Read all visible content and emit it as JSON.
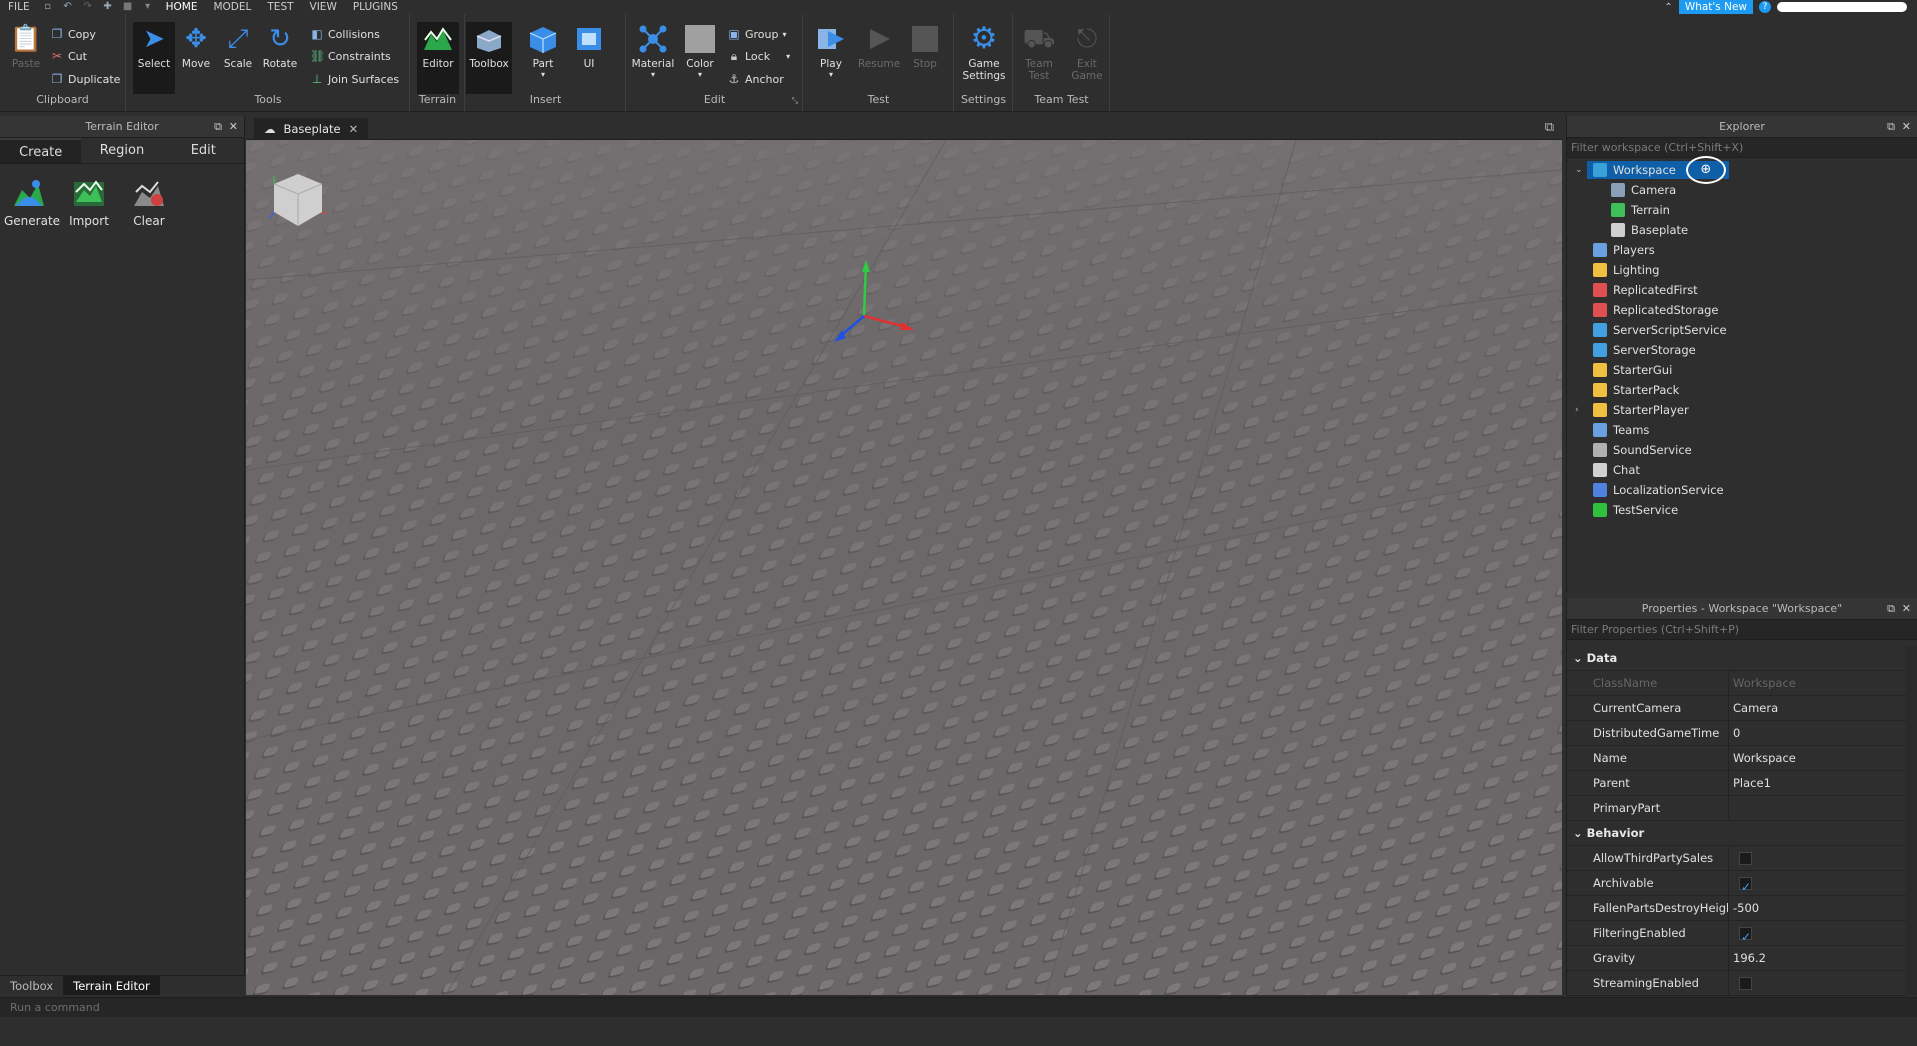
{
  "menubar": {
    "tabs": [
      "FILE",
      "HOME",
      "MODEL",
      "TEST",
      "VIEW",
      "PLUGINS"
    ],
    "whats_new": "What's New",
    "help": "?"
  },
  "ribbon": {
    "clipboard": {
      "label": "Clipboard",
      "paste": "Paste",
      "copy": "Copy",
      "cut": "Cut",
      "duplicate": "Duplicate"
    },
    "tools": {
      "label": "Tools",
      "select": "Select",
      "move": "Move",
      "scale": "Scale",
      "rotate": "Rotate",
      "collisions": "Collisions",
      "constraints": "Constraints",
      "join_surfaces": "Join Surfaces"
    },
    "terrain": {
      "label": "Terrain",
      "editor": "Editor"
    },
    "insert": {
      "label": "Insert",
      "toolbox": "Toolbox",
      "part": "Part",
      "ui": "UI"
    },
    "edit": {
      "label": "Edit",
      "material": "Material",
      "color": "Color",
      "group": "Group",
      "lock": "Lock",
      "anchor": "Anchor"
    },
    "test": {
      "label": "Test",
      "play": "Play",
      "resume": "Resume",
      "stop": "Stop"
    },
    "settings": {
      "label": "Settings",
      "game_settings_1": "Game",
      "game_settings_2": "Settings"
    },
    "team_test": {
      "label": "Team Test",
      "team_test_1": "Team",
      "team_test_2": "Test",
      "exit_game_1": "Exit",
      "exit_game_2": "Game"
    }
  },
  "terrain_editor": {
    "title": "Terrain Editor",
    "tabs": [
      "Create",
      "Region",
      "Edit"
    ],
    "tools": [
      "Generate",
      "Import",
      "Clear"
    ],
    "bottom_tabs": [
      "Toolbox",
      "Terrain Editor"
    ]
  },
  "document": {
    "tab": "Baseplate"
  },
  "explorer": {
    "title": "Explorer",
    "filter_placeholder": "Filter workspace (Ctrl+Shift+X)",
    "items": [
      {
        "label": "Workspace",
        "level": 0,
        "expanded": true,
        "color": "#3aa0d8"
      },
      {
        "label": "Camera",
        "level": 1,
        "color": "#8aa0b8"
      },
      {
        "label": "Terrain",
        "level": 1,
        "color": "#3fbf5a"
      },
      {
        "label": "Baseplate",
        "level": 1,
        "color": "#d0d0d0"
      },
      {
        "label": "Players",
        "level": 0,
        "color": "#6aa0e0"
      },
      {
        "label": "Lighting",
        "level": 0,
        "color": "#f0c040"
      },
      {
        "label": "ReplicatedFirst",
        "level": 0,
        "color": "#e05050"
      },
      {
        "label": "ReplicatedStorage",
        "level": 0,
        "color": "#e05050"
      },
      {
        "label": "ServerScriptService",
        "level": 0,
        "color": "#40a0e0"
      },
      {
        "label": "ServerStorage",
        "level": 0,
        "color": "#40a0e0"
      },
      {
        "label": "StarterGui",
        "level": 0,
        "color": "#f0c040"
      },
      {
        "label": "StarterPack",
        "level": 0,
        "color": "#f0c040"
      },
      {
        "label": "StarterPlayer",
        "level": 0,
        "collapsed": true,
        "color": "#f0c040"
      },
      {
        "label": "Teams",
        "level": 0,
        "color": "#6aa0e0"
      },
      {
        "label": "SoundService",
        "level": 0,
        "color": "#b0b0b0"
      },
      {
        "label": "Chat",
        "level": 0,
        "color": "#d0d0d0"
      },
      {
        "label": "LocalizationService",
        "level": 0,
        "color": "#5080e0"
      },
      {
        "label": "TestService",
        "level": 0,
        "color": "#30c040"
      }
    ]
  },
  "properties": {
    "title": "Properties - Workspace \"Workspace\"",
    "filter_placeholder": "Filter Properties (Ctrl+Shift+P)",
    "categories": [
      {
        "name": "Data",
        "rows": [
          {
            "name": "ClassName",
            "value": "Workspace",
            "dim": true
          },
          {
            "name": "CurrentCamera",
            "value": "Camera"
          },
          {
            "name": "DistributedGameTime",
            "value": "0"
          },
          {
            "name": "Name",
            "value": "Workspace"
          },
          {
            "name": "Parent",
            "value": "Place1"
          },
          {
            "name": "PrimaryPart",
            "value": ""
          }
        ]
      },
      {
        "name": "Behavior",
        "rows": [
          {
            "name": "AllowThirdPartySales",
            "check": false
          },
          {
            "name": "Archivable",
            "check": true
          },
          {
            "name": "FallenPartsDestroyHeight",
            "value": "-500"
          },
          {
            "name": "FilteringEnabled",
            "check": true
          },
          {
            "name": "Gravity",
            "value": "196.2"
          },
          {
            "name": "StreamingEnabled",
            "check": false
          }
        ]
      }
    ]
  },
  "command_bar": {
    "placeholder": "Run a command"
  }
}
